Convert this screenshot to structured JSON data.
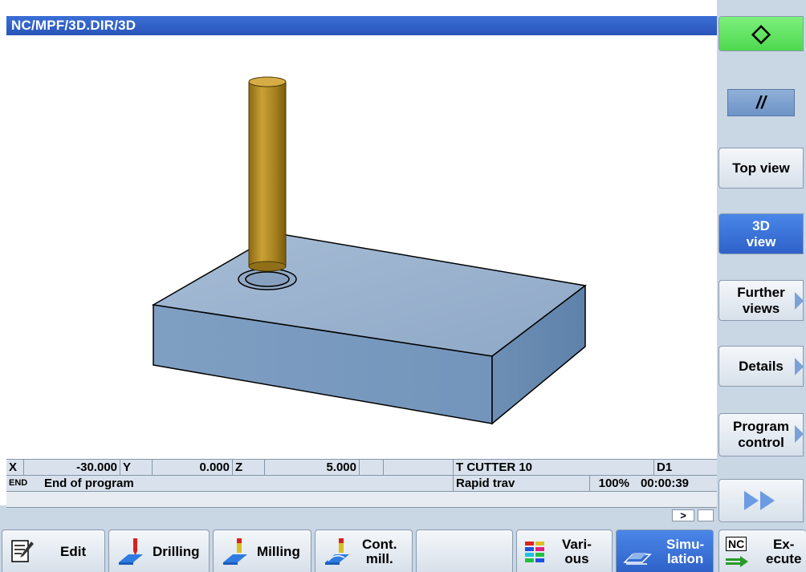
{
  "window": {
    "title": "NC/MPF/3D.DIR/3D"
  },
  "status": {
    "x_label": "X",
    "x_value": "-30.000",
    "y_label": "Y",
    "y_value": "0.000",
    "z_label": "Z",
    "z_value": "5.000",
    "tool": "T CUTTER 10",
    "d_number": "D1",
    "state_tag": "END",
    "message": "End of program",
    "feed_mode": "Rapid trav",
    "override": "100%",
    "time": "00:00:39",
    "scroll_right": ">"
  },
  "vertical_softkeys": {
    "start_symbol": "◇",
    "reset_symbol": "//",
    "top_view": "Top view",
    "view_3d_line1": "3D",
    "view_3d_line2": "view",
    "further_views_line1": "Further",
    "further_views_line2": "views",
    "details": "Details",
    "program_control_line1": "Program",
    "program_control_line2": "control"
  },
  "horizontal_softkeys": {
    "edit": "Edit",
    "drilling": "Drilling",
    "milling": "Milling",
    "cont_mill_line1": "Cont.",
    "cont_mill_line2": "mill.",
    "various_line1": "Vari-",
    "various_line2": "ous",
    "simulation_line1": "Simu-",
    "simulation_line2": "lation",
    "nc_badge": "NC",
    "execute_line1": "Ex-",
    "execute_line2": "ecute"
  },
  "colors": {
    "title_bar": "#2a55b8",
    "active_softkey": "#3b72d8",
    "start_green": "#5ee85e",
    "workpiece": "#7b9cc0",
    "tool": "#b8902a"
  }
}
